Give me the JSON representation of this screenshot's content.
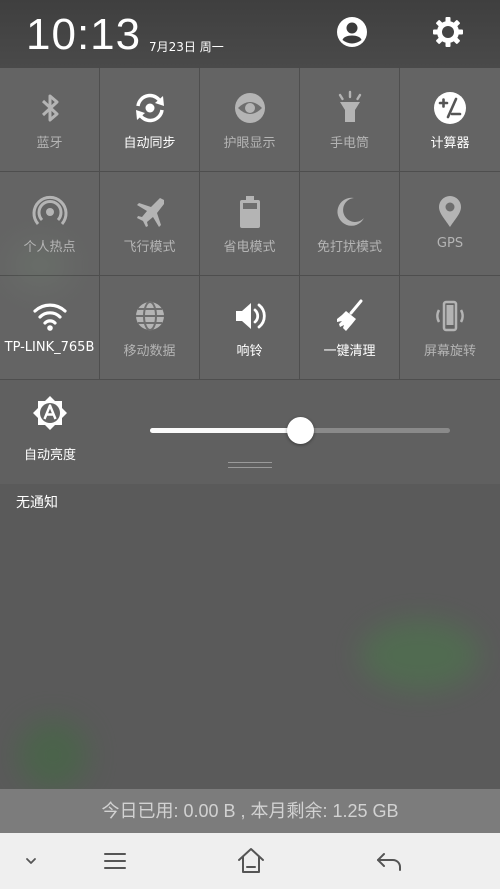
{
  "status": {
    "time": "10:13",
    "date": "7月23日 周一"
  },
  "header": {
    "user_icon": "user-avatar-icon",
    "settings_icon": "gear-icon"
  },
  "tiles": [
    {
      "label": "蓝牙",
      "icon": "bluetooth-icon",
      "active": false
    },
    {
      "label": "自动同步",
      "icon": "sync-icon",
      "active": true
    },
    {
      "label": "护眼显示",
      "icon": "eye-icon",
      "active": false
    },
    {
      "label": "手电筒",
      "icon": "flashlight-icon",
      "active": false
    },
    {
      "label": "计算器",
      "icon": "calculator-icon",
      "active": true
    },
    {
      "label": "个人热点",
      "icon": "hotspot-icon",
      "active": false
    },
    {
      "label": "飞行模式",
      "icon": "airplane-icon",
      "active": false
    },
    {
      "label": "省电模式",
      "icon": "battery-icon",
      "active": false
    },
    {
      "label": "免打扰模式",
      "icon": "moon-icon",
      "active": false
    },
    {
      "label": "GPS",
      "icon": "location-pin-icon",
      "active": false
    },
    {
      "label": "TP-LINK_765B",
      "icon": "wifi-icon",
      "active": true
    },
    {
      "label": "移动数据",
      "icon": "globe-icon",
      "active": false
    },
    {
      "label": "响铃",
      "icon": "speaker-icon",
      "active": true
    },
    {
      "label": "一键清理",
      "icon": "broom-icon",
      "active": true
    },
    {
      "label": "屏幕旋转",
      "icon": "screen-rotate-icon",
      "active": false
    }
  ],
  "brightness": {
    "auto_label": "自动亮度",
    "auto_icon": "auto-brightness-icon",
    "level": 0.5
  },
  "notifications": {
    "empty_text": "无通知"
  },
  "data_usage": {
    "text": "今日已用: 0.00 B , 本月剩余: 1.25 GB"
  },
  "navbar": {
    "icons": [
      "chevron-down-icon",
      "menu-icon",
      "home-icon",
      "back-icon"
    ]
  }
}
